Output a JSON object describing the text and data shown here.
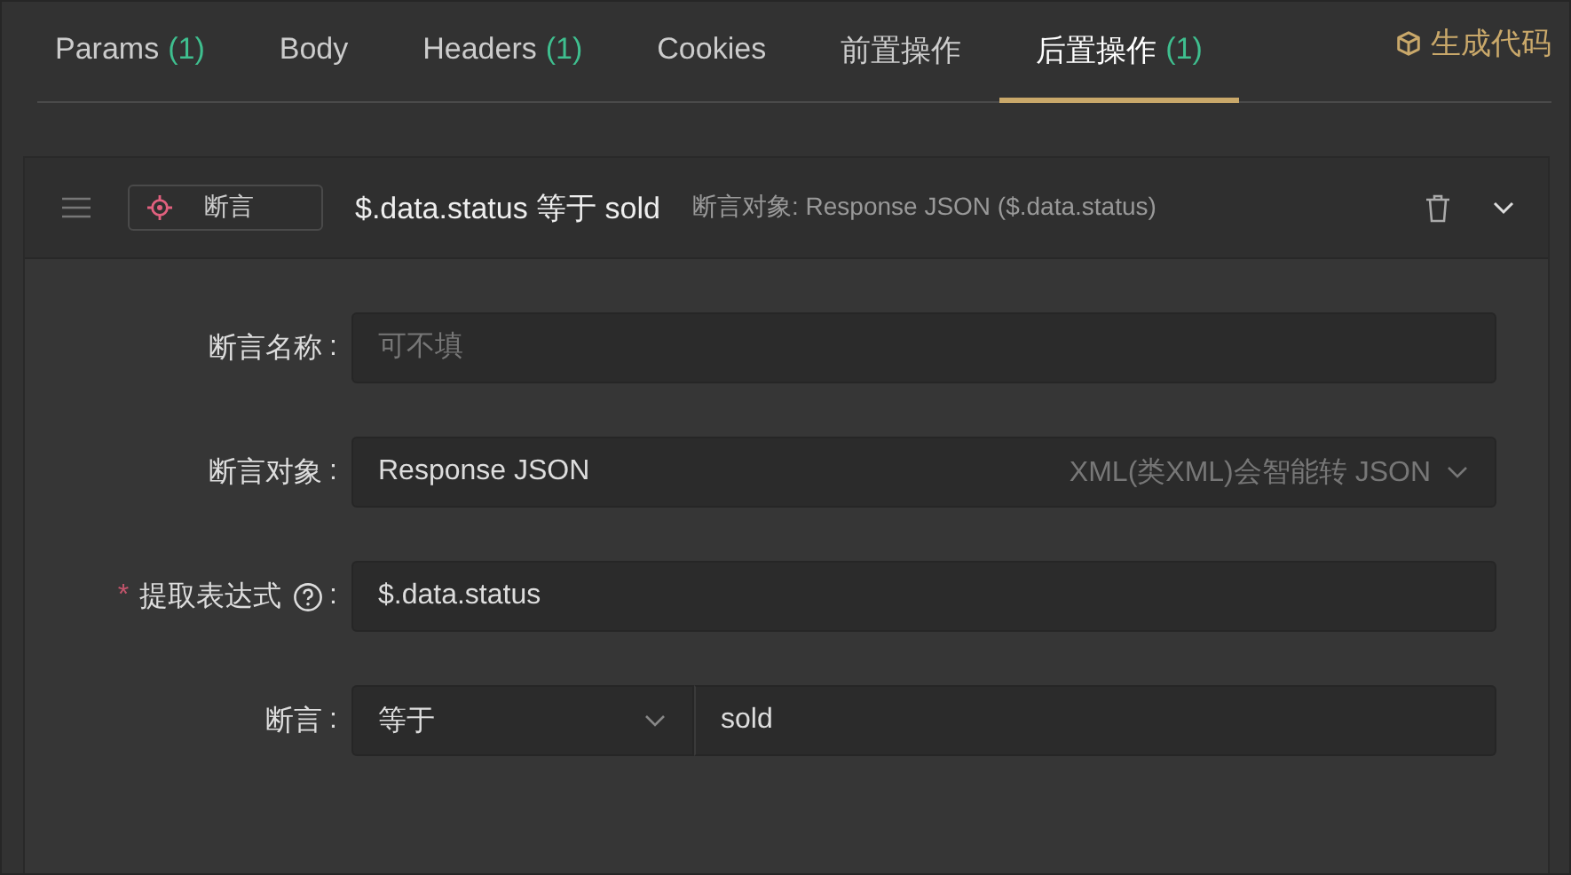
{
  "tabs": [
    {
      "label": "Params",
      "count": "(1)",
      "selected": false
    },
    {
      "label": "Body",
      "selected": false
    },
    {
      "label": "Headers",
      "count": "(1)",
      "selected": false
    },
    {
      "label": "Cookies",
      "selected": false
    },
    {
      "label": "前置操作",
      "selected": false
    },
    {
      "label": "后置操作",
      "count": "(1)",
      "selected": true
    }
  ],
  "generate_code": {
    "label": "生成代码"
  },
  "assertion": {
    "type_label": "断言",
    "title": "$.data.status 等于 sold",
    "subtitle": "断言对象: Response JSON ($.data.status)",
    "expanded": true,
    "required_mark": "*",
    "fields": [
      {
        "kind": "input",
        "label": "断言名称",
        "colon": ":",
        "required": false,
        "help": false,
        "placeholder": "可不填"
      },
      {
        "kind": "select",
        "label": "断言对象",
        "colon": ":",
        "required": false,
        "help": false,
        "value": "Response JSON",
        "hint": "XML(类XML)会智能转 JSON"
      },
      {
        "kind": "input",
        "label": "提取表达式",
        "colon": ":",
        "required": true,
        "help": true,
        "value": "$.data.status"
      },
      {
        "kind": "compare",
        "label": "断言",
        "colon": ":",
        "required": false,
        "help": false,
        "operator": "等于",
        "value": "sold"
      }
    ]
  }
}
